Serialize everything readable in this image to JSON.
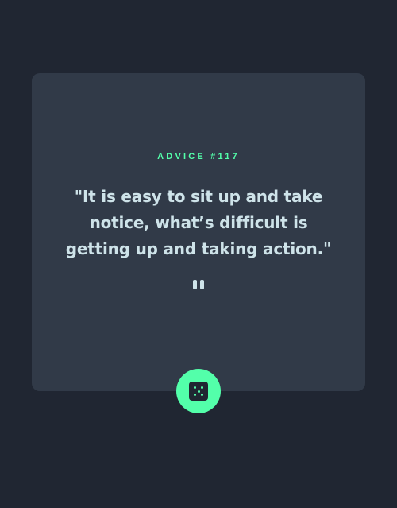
{
  "advice": {
    "id_label": "ADVICE #117",
    "quote": "\"It is easy to sit up and take notice, what’s difficult is getting up and taking action.\""
  },
  "icons": {
    "divider_icon": "pause-icon",
    "button_icon": "dice-icon"
  },
  "colors": {
    "background": "#202632",
    "card": "#313a48",
    "accent": "#53ffaa",
    "text": "#cee3e9",
    "divider": "#4f5d74"
  }
}
